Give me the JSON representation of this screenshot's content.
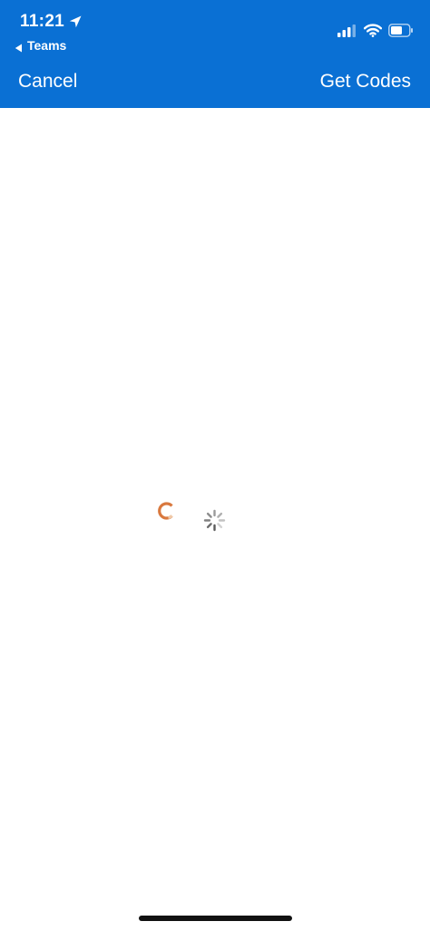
{
  "status_bar": {
    "time": "11:21",
    "back_app": "Teams",
    "icons": [
      "location-arrow-icon",
      "signal-icon",
      "wifi-icon",
      "battery-icon"
    ]
  },
  "nav": {
    "cancel_label": "Cancel",
    "get_codes_label": "Get Codes",
    "bar_color": "#0a70d4"
  },
  "content": {
    "loading_indicators": [
      "orange-ring-spinner",
      "gray-activity-spinner"
    ],
    "spinner_accent": "#d9793f"
  }
}
